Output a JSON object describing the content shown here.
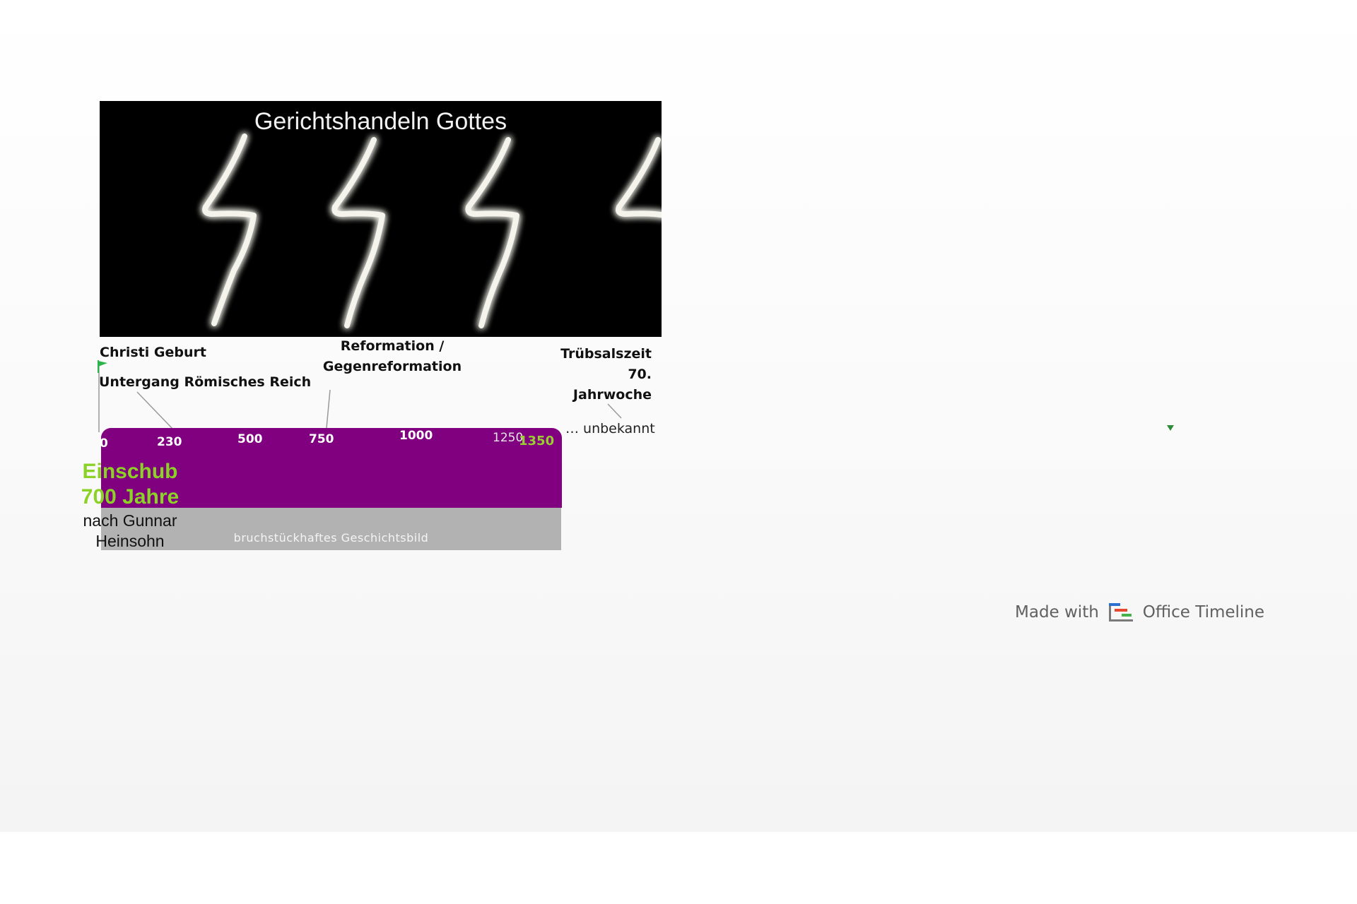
{
  "banner": {
    "title": "Gerichtshandeln Gottes"
  },
  "milestones": {
    "christi_geburt": "Christi Geburt",
    "untergang": "Untergang Römisches Reich",
    "reformation_line1": "Reformation /",
    "reformation_line2": "Gegenreformation",
    "truebsal_line1": "Trübsalszeit",
    "truebsal_line2": "70.",
    "truebsal_line3": "Jahrwoche",
    "unbekannt": "… unbekannt"
  },
  "timeline": {
    "ticks": [
      "0",
      "230",
      "500",
      "750",
      "1000",
      "1250",
      "1350"
    ],
    "band_label": "bruchstückhaftes Geschichtsbild"
  },
  "insert": {
    "line1": "Einschub",
    "line2": "700 Jahre",
    "line3": "nach Gunnar",
    "line4": "Heinsohn"
  },
  "branding": {
    "prefix": "Made with",
    "product": "Office Timeline"
  },
  "colors": {
    "bar": "#800080",
    "band": "#b2b2b2",
    "accent_green": "#8cd226",
    "flag_green": "#2db34a",
    "banner_bg": "#000000"
  },
  "icons": [
    "lightning-bolt-icon",
    "flag-icon",
    "triangle-down-icon",
    "office-timeline-logo-icon"
  ]
}
